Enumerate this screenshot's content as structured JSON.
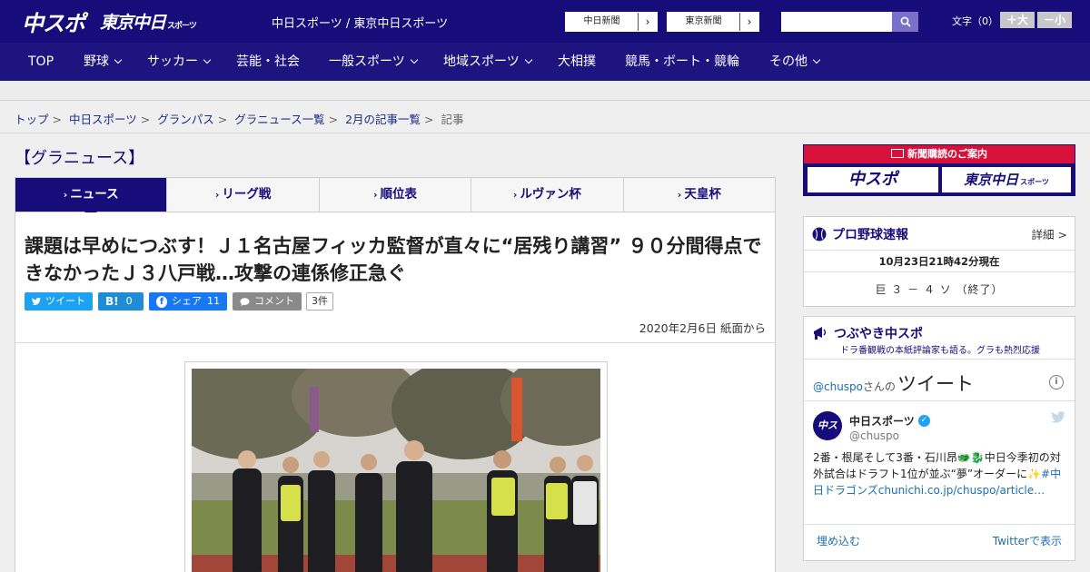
{
  "header": {
    "logo_chuspo": "中スポ",
    "logo_tokyo": "東京中日",
    "logo_tokyo_sub": "スポーツ",
    "site_title": "中日スポーツ / 東京中日スポーツ",
    "ext_links": [
      {
        "label": "中日新聞",
        "arrow": "›"
      },
      {
        "label": "東京新聞",
        "arrow": "›"
      }
    ],
    "search_placeholder": "",
    "font_size_label": "文字（0）",
    "font_plus": "＋大",
    "font_minus": "－小"
  },
  "nav": {
    "items": [
      {
        "label": "TOP",
        "dropdown": false
      },
      {
        "label": "野球",
        "dropdown": true
      },
      {
        "label": "サッカー",
        "dropdown": true
      },
      {
        "label": "芸能・社会",
        "dropdown": false
      },
      {
        "label": "一般スポーツ",
        "dropdown": true
      },
      {
        "label": "地域スポーツ",
        "dropdown": true
      },
      {
        "label": "大相撲",
        "dropdown": false
      },
      {
        "label": "競馬・ボート・競輪",
        "dropdown": false
      },
      {
        "label": "その他",
        "dropdown": true
      }
    ]
  },
  "breadcrumb": {
    "links": [
      "トップ",
      "中日スポーツ",
      "グランパス",
      "グラニュース一覧",
      "2月の記事一覧"
    ],
    "current": "記事",
    "separator": ">"
  },
  "main": {
    "section_title": "【グラニュース】",
    "tabs": [
      {
        "label": "ニュース",
        "active": true
      },
      {
        "label": "リーグ戦",
        "active": false
      },
      {
        "label": "順位表",
        "active": false
      },
      {
        "label": "ルヴァン杯",
        "active": false
      },
      {
        "label": "天皇杯",
        "active": false
      }
    ],
    "tab_marker": "›",
    "headline": "課題は早めにつぶす！Ｊ１名古屋フィッカ監督が直々に“居残り講習” ９０分間得点できなかったＪ３八戸戦…攻撃の連係修正急ぐ",
    "share": {
      "tweet": "ツイート",
      "hatena_label": "B!",
      "hatena_count": "0",
      "facebook": "シェア",
      "facebook_count": "11",
      "comment": "コメント",
      "comment_count": "3件"
    },
    "date": "2020年2月6日 紙面から"
  },
  "sidebar": {
    "subscribe": {
      "caption": "新聞購読のご案内",
      "chuspo": "中スポ",
      "tokyo": "東京中日",
      "tokyo_sub": "スポーツ"
    },
    "baseball": {
      "title": "プロ野球速報",
      "more": "詳細 >",
      "timestamp": "10月23日21時42分現在",
      "score": "巨 ３ － ４ ソ （終了）"
    },
    "twitter": {
      "title": "つぶやき中スポ",
      "subtitle": "ドラ番観戦の本紙評論家も語る。グラも熱烈応援",
      "handle_link": "@chuspo",
      "handle_suffix": "さんの",
      "tweet_word": "ツイート",
      "info": "i",
      "avatar_text": "中スポ",
      "account_name": "中日スポーツ",
      "verified": "✓",
      "account_handle": "@chuspo",
      "tweet_text": "2番・根尾そして3番・石川昂🐲🐉中日今季初の対外試合はドラフト1位が並ぶ“夢”オーダーに✨",
      "tweet_hashtag": "#中日ドラゴンズ",
      "tweet_link": "chunichi.co.jp/chuspo/article…",
      "embed": "埋め込む",
      "view_on": "Twitterで表示"
    }
  }
}
